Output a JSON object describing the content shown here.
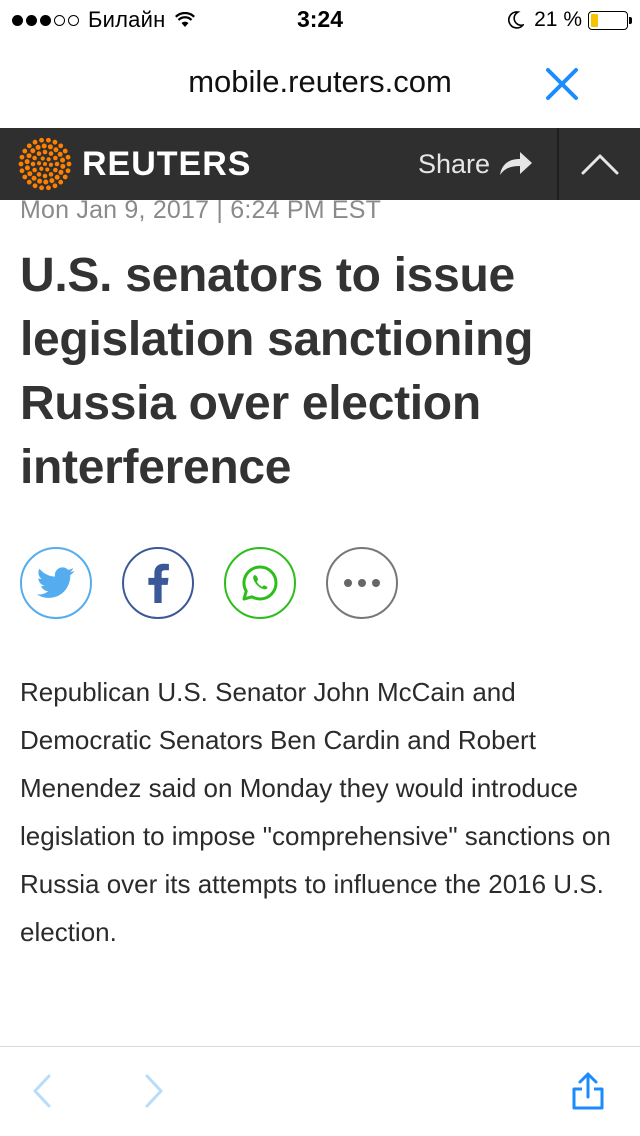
{
  "status_bar": {
    "carrier": "Билайн",
    "time": "3:24",
    "battery_percent": "21 %",
    "battery_level": 0.21,
    "signal_bars_filled": 3,
    "signal_bars_total": 5
  },
  "url_bar": {
    "url": "mobile.reuters.com"
  },
  "header": {
    "brand": "REUTERS",
    "share_label": "Share",
    "brand_color": "#ff8000",
    "background_color": "#2f2f2f"
  },
  "article": {
    "dateline": "Mon Jan 9, 2017 | 6:24 PM EST",
    "headline": "U.S. senators to issue legislation sanctioning Russia over election interference",
    "body": "Republican U.S. Senator John McCain and Democratic Senators Ben Cardin and Robert Menendez said on Monday they would introduce legislation to impose \"comprehensive\" sanctions on Russia over its attempts to influence the 2016 U.S. election."
  },
  "share_buttons": [
    {
      "name": "twitter",
      "icon": "twitter-bird-icon",
      "color": "#55acee"
    },
    {
      "name": "facebook",
      "icon": "facebook-f-icon",
      "color": "#3b5998"
    },
    {
      "name": "whatsapp",
      "icon": "whatsapp-phone-icon",
      "color": "#2dbe1c"
    },
    {
      "name": "more",
      "icon": "ellipsis-icon",
      "color": "#777777"
    }
  ],
  "toolbar": {
    "accent_color": "#1a8cff",
    "disabled_color": "#b8dcfb"
  }
}
